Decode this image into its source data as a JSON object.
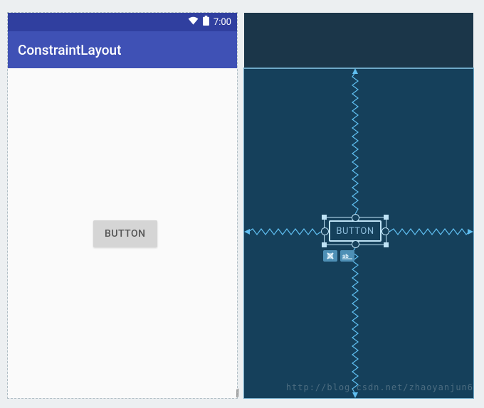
{
  "design": {
    "status": {
      "clock": "7:00"
    },
    "app_bar_title": "ConstraintLayout",
    "button_label": "BUTTON"
  },
  "blueprint": {
    "button_label": "BUTTON"
  },
  "watermark": "http://blog.csdn.net/zhaoyanjun6"
}
